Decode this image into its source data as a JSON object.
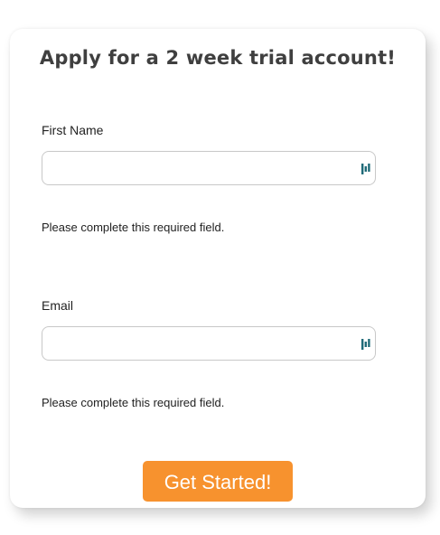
{
  "form": {
    "title": "Apply for a 2 week trial account!",
    "fields": [
      {
        "label": "First Name",
        "value": "",
        "icon": "password-manager-icon",
        "error": "Please complete this required field."
      },
      {
        "label": "Email",
        "value": "",
        "icon": "password-manager-icon",
        "error": "Please complete this required field."
      }
    ],
    "submit_label": "Get Started!"
  },
  "colors": {
    "accent": "#f7922e",
    "icon": "#1f6a78",
    "title": "#3f3f3f"
  }
}
